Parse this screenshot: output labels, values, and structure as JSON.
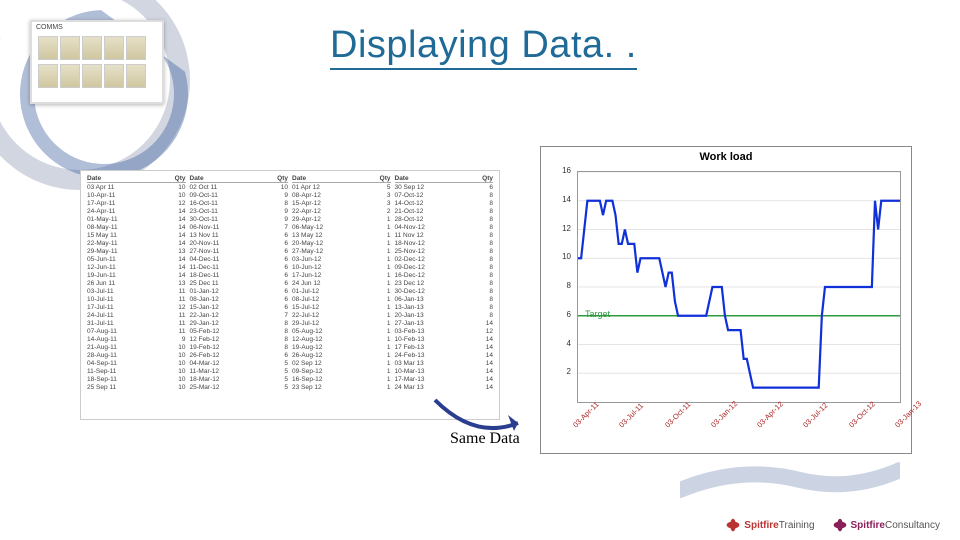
{
  "title": "Displaying Data. .",
  "same_data_label": "Same Data",
  "table_headers": {
    "date": "Date",
    "qty": "Qty"
  },
  "table_columns": [
    {
      "rows": [
        {
          "d": "03 Apr 11",
          "q": "10"
        },
        {
          "d": "10-Apr-11",
          "q": "10"
        },
        {
          "d": "17-Apr-11",
          "q": "12"
        },
        {
          "d": "24-Apr-11",
          "q": "14"
        },
        {
          "d": "01-May-11",
          "q": "14"
        },
        {
          "d": "08-May-11",
          "q": "14"
        },
        {
          "d": "15 May 11",
          "q": "14"
        },
        {
          "d": "22-May-11",
          "q": "14"
        },
        {
          "d": "29-May-11",
          "q": "13"
        },
        {
          "d": "05-Jun-11",
          "q": "14"
        },
        {
          "d": "12-Jun-11",
          "q": "14"
        },
        {
          "d": "19-Jun-11",
          "q": "14"
        },
        {
          "d": "26 Jun 11",
          "q": "13"
        },
        {
          "d": "03-Jul-11",
          "q": "11"
        },
        {
          "d": "10-Jul-11",
          "q": "11"
        },
        {
          "d": "17-Jul-11",
          "q": "12"
        },
        {
          "d": "24-Jul-11",
          "q": "11"
        },
        {
          "d": "31-Jul-11",
          "q": "11"
        },
        {
          "d": "07-Aug-11",
          "q": "11"
        },
        {
          "d": "14-Aug-11",
          "q": "9"
        },
        {
          "d": "21-Aug-11",
          "q": "10"
        },
        {
          "d": "28-Aug-11",
          "q": "10"
        },
        {
          "d": "04-Sep-11",
          "q": "10"
        },
        {
          "d": "11-Sep-11",
          "q": "10"
        },
        {
          "d": "18-Sep-11",
          "q": "10"
        },
        {
          "d": "25 Sep 11",
          "q": "10"
        }
      ]
    },
    {
      "rows": [
        {
          "d": "02 Oct 11",
          "q": "10"
        },
        {
          "d": "09-Oct-11",
          "q": "9"
        },
        {
          "d": "16-Oct-11",
          "q": "8"
        },
        {
          "d": "23-Oct-11",
          "q": "9"
        },
        {
          "d": "30-Oct-11",
          "q": "9"
        },
        {
          "d": "06-Nov-11",
          "q": "7"
        },
        {
          "d": "13 Nov 11",
          "q": "6"
        },
        {
          "d": "20-Nov-11",
          "q": "6"
        },
        {
          "d": "27-Nov-11",
          "q": "6"
        },
        {
          "d": "04-Dec-11",
          "q": "6"
        },
        {
          "d": "11-Dec-11",
          "q": "6"
        },
        {
          "d": "18-Dec-11",
          "q": "6"
        },
        {
          "d": "25 Dec 11",
          "q": "6"
        },
        {
          "d": "01-Jan-12",
          "q": "6"
        },
        {
          "d": "08-Jan-12",
          "q": "6"
        },
        {
          "d": "15-Jan-12",
          "q": "6"
        },
        {
          "d": "22-Jan-12",
          "q": "7"
        },
        {
          "d": "29-Jan-12",
          "q": "8"
        },
        {
          "d": "05-Feb-12",
          "q": "8"
        },
        {
          "d": "12 Feb-12",
          "q": "8"
        },
        {
          "d": "19-Feb-12",
          "q": "8"
        },
        {
          "d": "26-Feb-12",
          "q": "6"
        },
        {
          "d": "04-Mar-12",
          "q": "5"
        },
        {
          "d": "11-Mar-12",
          "q": "5"
        },
        {
          "d": "18-Mar-12",
          "q": "5"
        },
        {
          "d": "25-Mar-12",
          "q": "5"
        }
      ]
    },
    {
      "rows": [
        {
          "d": "01 Apr 12",
          "q": "5"
        },
        {
          "d": "08-Apr-12",
          "q": "3"
        },
        {
          "d": "15-Apr-12",
          "q": "3"
        },
        {
          "d": "22-Apr-12",
          "q": "2"
        },
        {
          "d": "29-Apr-12",
          "q": "1"
        },
        {
          "d": "06-May-12",
          "q": "1"
        },
        {
          "d": "13 May 12",
          "q": "1"
        },
        {
          "d": "20-May-12",
          "q": "1"
        },
        {
          "d": "27-May-12",
          "q": "1"
        },
        {
          "d": "03-Jun-12",
          "q": "1"
        },
        {
          "d": "10-Jun-12",
          "q": "1"
        },
        {
          "d": "17-Jun-12",
          "q": "1"
        },
        {
          "d": "24 Jun 12",
          "q": "1"
        },
        {
          "d": "01-Jul-12",
          "q": "1"
        },
        {
          "d": "08-Jul-12",
          "q": "1"
        },
        {
          "d": "15-Jul-12",
          "q": "1"
        },
        {
          "d": "22-Jul-12",
          "q": "1"
        },
        {
          "d": "29-Jul-12",
          "q": "1"
        },
        {
          "d": "05-Aug-12",
          "q": "1"
        },
        {
          "d": "12-Aug-12",
          "q": "1"
        },
        {
          "d": "19-Aug-12",
          "q": "1"
        },
        {
          "d": "26-Aug-12",
          "q": "1"
        },
        {
          "d": "02 Sep 12",
          "q": "1"
        },
        {
          "d": "09-Sep-12",
          "q": "1"
        },
        {
          "d": "16-Sep-12",
          "q": "1"
        },
        {
          "d": "23 Sep 12",
          "q": "1"
        }
      ]
    },
    {
      "rows": [
        {
          "d": "30 Sep 12",
          "q": "6"
        },
        {
          "d": "07-Oct-12",
          "q": "8"
        },
        {
          "d": "14-Oct-12",
          "q": "8"
        },
        {
          "d": "21-Oct-12",
          "q": "8"
        },
        {
          "d": "28-Oct-12",
          "q": "8"
        },
        {
          "d": "04-Nov-12",
          "q": "8"
        },
        {
          "d": "11 Nov 12",
          "q": "8"
        },
        {
          "d": "18-Nov-12",
          "q": "8"
        },
        {
          "d": "25-Nov-12",
          "q": "8"
        },
        {
          "d": "02-Dec-12",
          "q": "8"
        },
        {
          "d": "09-Dec-12",
          "q": "8"
        },
        {
          "d": "16-Dec-12",
          "q": "8"
        },
        {
          "d": "23 Dec 12",
          "q": "8"
        },
        {
          "d": "30-Dec-12",
          "q": "8"
        },
        {
          "d": "06-Jan-13",
          "q": "8"
        },
        {
          "d": "13-Jan-13",
          "q": "8"
        },
        {
          "d": "20-Jan-13",
          "q": "8"
        },
        {
          "d": "27-Jan-13",
          "q": "14"
        },
        {
          "d": "03-Feb-13",
          "q": "12"
        },
        {
          "d": "10-Feb-13",
          "q": "14"
        },
        {
          "d": "17 Feb-13",
          "q": "14"
        },
        {
          "d": "24-Feb-13",
          "q": "14"
        },
        {
          "d": "03 Mar 13",
          "q": "14"
        },
        {
          "d": "10-Mar-13",
          "q": "14"
        },
        {
          "d": "17-Mar-13",
          "q": "14"
        },
        {
          "d": "24 Mar 13",
          "q": "14"
        }
      ]
    }
  ],
  "chart_data": {
    "type": "line",
    "title": "Work load",
    "xlabel": "",
    "ylabel": "",
    "ylim": [
      0,
      16
    ],
    "yticks": [
      2,
      4,
      6,
      8,
      10,
      12,
      14,
      16
    ],
    "target": 6,
    "target_label": "Target",
    "xticks": [
      "03-Apr-11",
      "03-Jul-11",
      "03-Oct-11",
      "03-Jan-12",
      "03-Apr-12",
      "03-Jul-12",
      "03-Oct-12",
      "03-Jan-13"
    ],
    "series": [
      {
        "name": "Qty",
        "color": "#1030d8",
        "values": [
          10,
          10,
          12,
          14,
          14,
          14,
          14,
          14,
          13,
          14,
          14,
          14,
          13,
          11,
          11,
          12,
          11,
          11,
          11,
          9,
          10,
          10,
          10,
          10,
          10,
          10,
          10,
          9,
          8,
          9,
          9,
          7,
          6,
          6,
          6,
          6,
          6,
          6,
          6,
          6,
          6,
          6,
          7,
          8,
          8,
          8,
          8,
          6,
          5,
          5,
          5,
          5,
          5,
          3,
          3,
          2,
          1,
          1,
          1,
          1,
          1,
          1,
          1,
          1,
          1,
          1,
          1,
          1,
          1,
          1,
          1,
          1,
          1,
          1,
          1,
          1,
          1,
          1,
          6,
          8,
          8,
          8,
          8,
          8,
          8,
          8,
          8,
          8,
          8,
          8,
          8,
          8,
          8,
          8,
          8,
          14,
          12,
          14,
          14,
          14,
          14,
          14,
          14,
          14
        ]
      }
    ]
  },
  "footer": {
    "left_logo": "SpitfireTraining",
    "right_logo": "SpitfireConsultancy"
  },
  "ornament_board_label": "COMMS"
}
